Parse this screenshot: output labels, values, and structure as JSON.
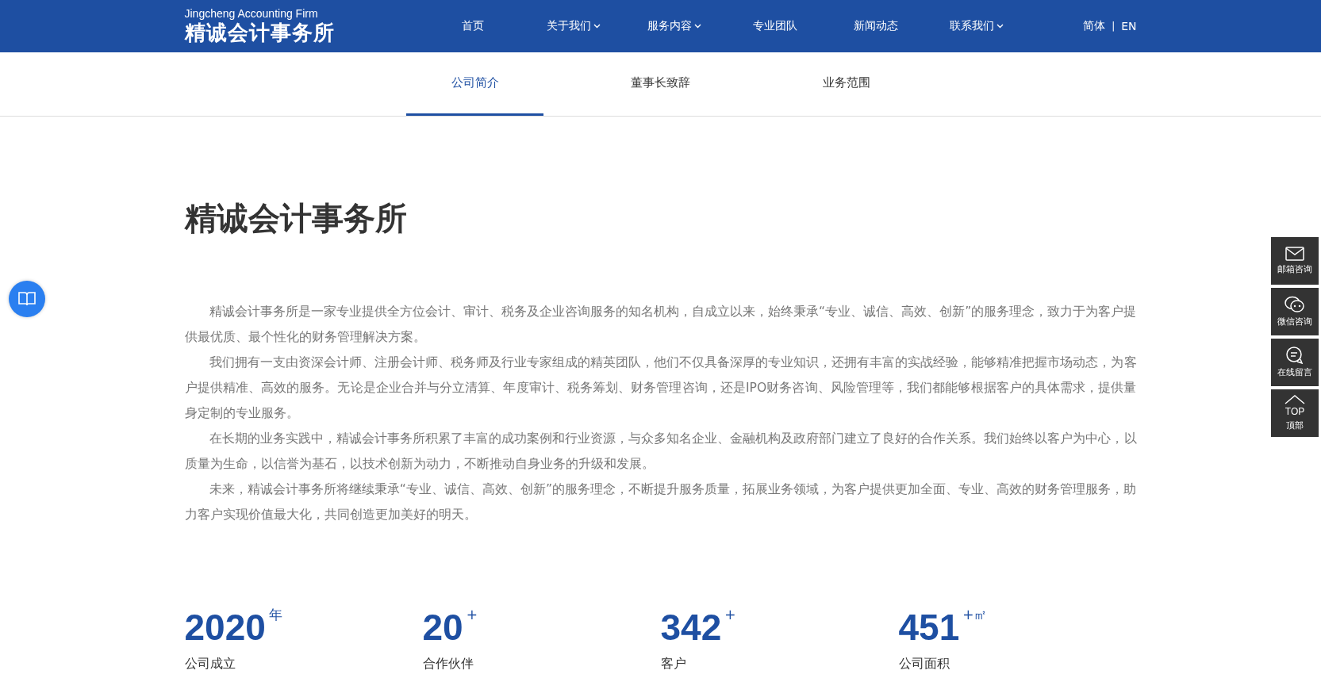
{
  "header": {
    "logo_en": "Jingcheng Accounting Firm",
    "logo_cn": "精诚会计事务所",
    "nav": [
      {
        "label": "首页",
        "dropdown": false
      },
      {
        "label": "关于我们",
        "dropdown": true
      },
      {
        "label": "服务内容",
        "dropdown": true
      },
      {
        "label": "专业团队",
        "dropdown": false
      },
      {
        "label": "新闻动态",
        "dropdown": false
      },
      {
        "label": "联系我们",
        "dropdown": true
      }
    ],
    "languages": [
      "简体",
      "EN"
    ],
    "language_separator": "|"
  },
  "tabs": [
    {
      "label": "公司简介",
      "selected": true
    },
    {
      "label": "董事长致辞",
      "selected": false
    },
    {
      "label": "业务范围",
      "selected": false
    }
  ],
  "title": "精诚会计事务所",
  "paragraphs": [
    "精诚会计事务所是一家专业提供全方位会计、审计、税务及企业咨询服务的知名机构，自成立以来，始终秉承“专业、诚信、高效、创新”的服务理念，致力于为客户提供最优质、最个性化的财务管理解决方案。",
    "我们拥有一支由资深会计师、注册会计师、税务师及行业专家组成的精英团队，他们不仅具备深厚的专业知识，还拥有丰富的实战经验，能够精准把握市场动态，为客户提供精准、高效的服务。无论是企业合并与分立清算、年度审计、税务筹划、财务管理咨询，还是IPO财务咨询、风险管理等，我们都能够根据客户的具体需求，提供量身定制的专业服务。",
    "在长期的业务实践中，精诚会计事务所积累了丰富的成功案例和行业资源，与众多知名企业、金融机构及政府部门建立了良好的合作关系。我们始终以客户为中心，以质量为生命，以信誉为基石，以技术创新为动力，不断推动自身业务的升级和发展。",
    "未来，精诚会计事务所将继续秉承“专业、诚信、高效、创新”的服务理念，不断提升服务质量，拓展业务领域，为客户提供更加全面、专业、高效的财务管理服务，助力客户实现价值最大化，共同创造更加美好的明天。"
  ],
  "stats": [
    {
      "value": "2020",
      "suffix": "年",
      "label": "公司成立"
    },
    {
      "value": "20",
      "suffix": "+",
      "label": "合作伙伴"
    },
    {
      "value": "342",
      "suffix": "+",
      "label": "客户"
    },
    {
      "value": "451",
      "suffix": "+㎡",
      "label": "公司面积"
    }
  ],
  "side_tools": [
    {
      "kind": "mail",
      "label": "邮箱咨询"
    },
    {
      "kind": "wechat",
      "label": "微信咨询"
    },
    {
      "kind": "message",
      "label": "在线留言"
    },
    {
      "kind": "top",
      "top_text": "TOP",
      "label": "顶部"
    }
  ]
}
